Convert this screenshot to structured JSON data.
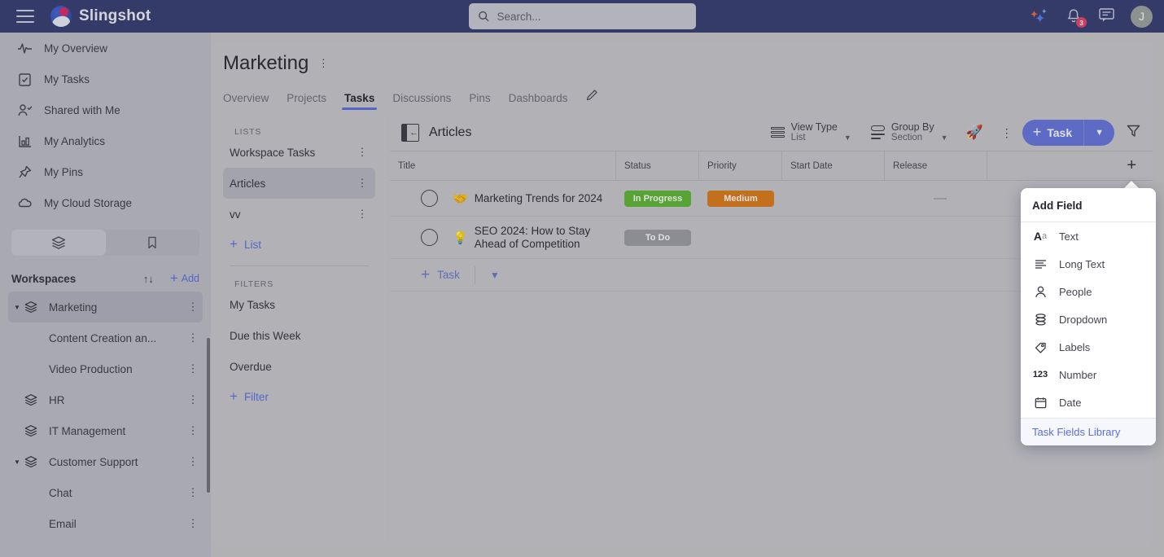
{
  "topbar": {
    "menu_icon": "hamburger-icon",
    "brand": "Slingshot",
    "search": {
      "placeholder": "Search...",
      "value": "",
      "icon": "search-icon"
    },
    "ai_icon": "sparkle-ai-icon",
    "notifications": {
      "icon": "bell-icon",
      "count": "3"
    },
    "messages_icon": "chat-icon",
    "avatar_initial": "J"
  },
  "sidebar": {
    "nav": [
      {
        "label": "My Overview",
        "icon": "activity-icon"
      },
      {
        "label": "My Tasks",
        "icon": "clipboard-check-icon"
      },
      {
        "label": "Shared with Me",
        "icon": "user-check-icon"
      },
      {
        "label": "My Analytics",
        "icon": "bar-chart-icon"
      },
      {
        "label": "My Pins",
        "icon": "pin-icon"
      },
      {
        "label": "My Cloud Storage",
        "icon": "cloud-icon"
      }
    ],
    "segments": [
      {
        "icon": "layers-icon",
        "active": true
      },
      {
        "icon": "bookmark-icon",
        "active": false
      }
    ],
    "workspaces_title": "Workspaces",
    "sort_icon": "sort-arrows-icon",
    "add_label": "Add",
    "workspaces": [
      {
        "label": "Marketing",
        "level": 0,
        "expanded": true,
        "selected": true
      },
      {
        "label": "Content Creation an...",
        "level": 1,
        "expanded": false,
        "selected": false
      },
      {
        "label": "Video Production",
        "level": 1,
        "expanded": false,
        "selected": false
      },
      {
        "label": "HR",
        "level": 0,
        "expanded": false,
        "selected": false
      },
      {
        "label": "IT Management",
        "level": 0,
        "expanded": false,
        "selected": false
      },
      {
        "label": "Customer Support",
        "level": 0,
        "expanded": true,
        "selected": false
      },
      {
        "label": "Chat",
        "level": 1,
        "expanded": false,
        "selected": false
      },
      {
        "label": "Email",
        "level": 1,
        "expanded": false,
        "selected": false
      }
    ]
  },
  "project": {
    "title": "Marketing",
    "menu_icon": "kebab-menu-icon",
    "edit_icon": "pencil-icon",
    "tabs": [
      {
        "label": "Overview",
        "active": false
      },
      {
        "label": "Projects",
        "active": false
      },
      {
        "label": "Tasks",
        "active": true
      },
      {
        "label": "Discussions",
        "active": false
      },
      {
        "label": "Pins",
        "active": false
      },
      {
        "label": "Dashboards",
        "active": false
      }
    ]
  },
  "lists_panel": {
    "lists_heading": "LISTS",
    "lists": [
      {
        "label": "Workspace Tasks",
        "selected": false
      },
      {
        "label": "Articles",
        "selected": true
      },
      {
        "label": "vv",
        "selected": false
      }
    ],
    "add_list_label": "List",
    "filters_heading": "FILTERS",
    "filters": [
      {
        "label": "My Tasks"
      },
      {
        "label": "Due this Week"
      },
      {
        "label": "Overdue"
      }
    ],
    "add_filter_label": "Filter"
  },
  "table_panel": {
    "collapse_icon": "collapse-panel-icon",
    "title": "Articles",
    "controls": {
      "view_type": {
        "label": "View Type",
        "value": "List",
        "icon": "list-view-icon"
      },
      "group_by": {
        "label": "Group By",
        "value": "Section",
        "icon": "group-by-icon"
      },
      "rocket_icon": "rocket-icon",
      "more_icon": "kebab-menu-icon",
      "task_button": "Task",
      "task_button_caret": "chevron-down-icon",
      "filter_icon": "funnel-filter-icon"
    },
    "columns": [
      "Title",
      "Status",
      "Priority",
      "Start Date",
      "Release"
    ],
    "add_field_plus": "+",
    "rows": [
      {
        "emoji": "🤝",
        "title": "Marketing Trends for 2024",
        "status": {
          "label": "In Progress",
          "color": "#5cb832"
        },
        "priority": {
          "label": "Medium",
          "color": "#dd7a16"
        },
        "start_date": "",
        "release": "—"
      },
      {
        "emoji": "💡",
        "title": "SEO 2024: How to Stay Ahead of Competition",
        "status": {
          "label": "To Do",
          "color": "#9b9ca3"
        },
        "priority": {
          "label": "",
          "color": ""
        },
        "start_date": "",
        "release": ""
      }
    ],
    "add_task_label": "Task",
    "add_task_caret": "chevron-down-icon"
  },
  "add_field_dropdown": {
    "heading": "Add Field",
    "items": [
      {
        "label": "Text",
        "icon": "text-aa-icon"
      },
      {
        "label": "Long Text",
        "icon": "long-text-lines-icon"
      },
      {
        "label": "People",
        "icon": "person-icon"
      },
      {
        "label": "Dropdown",
        "icon": "dropdown-stack-icon"
      },
      {
        "label": "Labels",
        "icon": "tag-icon"
      },
      {
        "label": "Number",
        "icon": "number-123-icon"
      },
      {
        "label": "Date",
        "icon": "calendar-icon"
      }
    ],
    "footer_link": "Task Fields Library"
  },
  "colors": {
    "topbar": "#343b6f",
    "accent": "#5b6ee0",
    "primary_button": "#6474dd",
    "status_in_progress": "#5cb832",
    "status_to_do": "#9b9ca3",
    "priority_medium": "#dd7a16"
  }
}
